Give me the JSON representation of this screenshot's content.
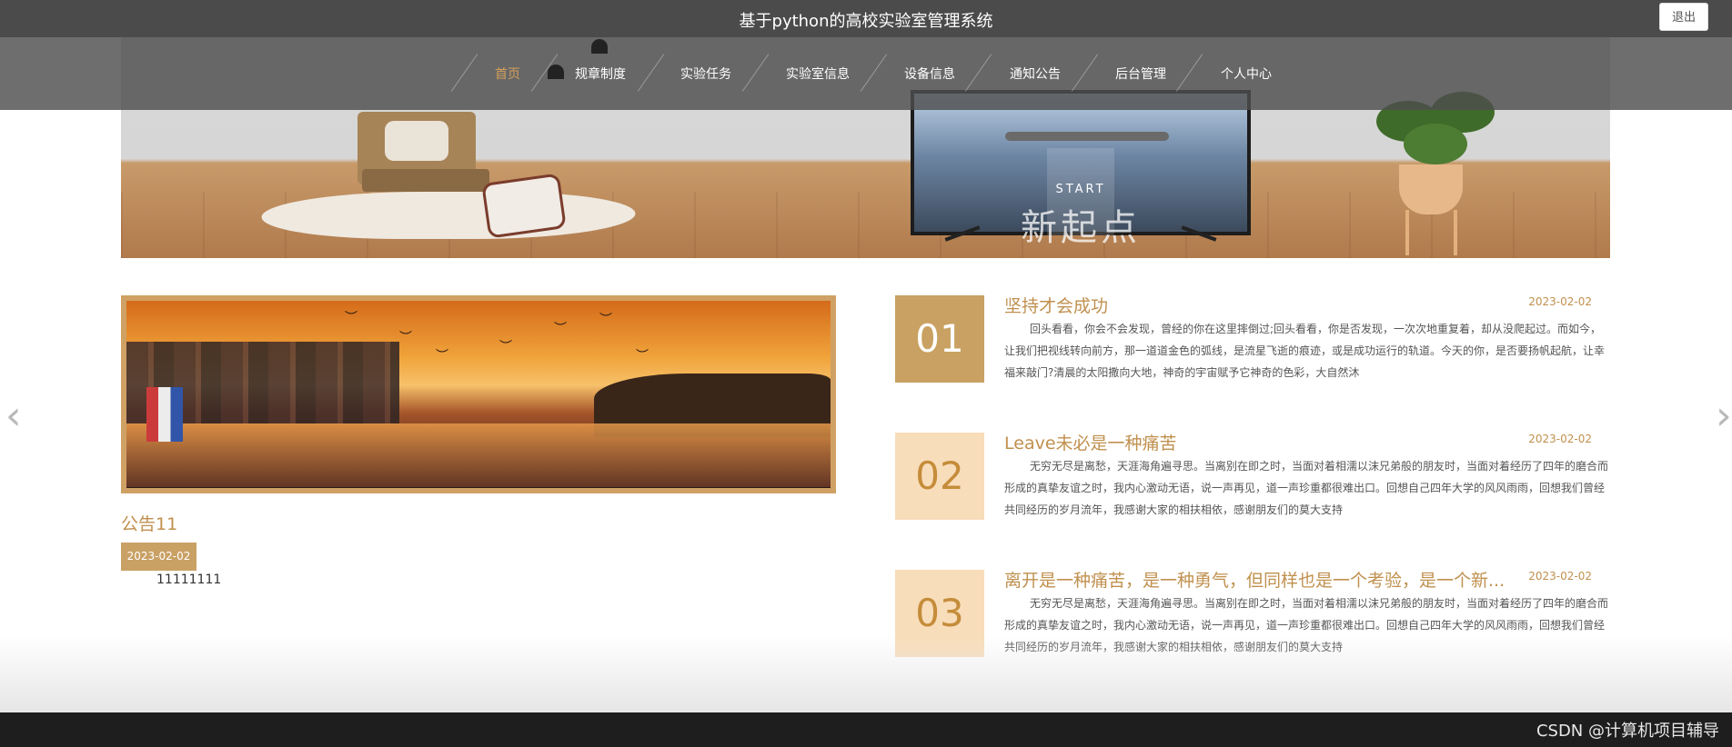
{
  "app": {
    "title": "基于python的高校实验室管理系统",
    "logout_label": "退出"
  },
  "nav": {
    "items": [
      {
        "label": "首页",
        "active": true
      },
      {
        "label": "规章制度"
      },
      {
        "label": "实验任务"
      },
      {
        "label": "实验室信息"
      },
      {
        "label": "设备信息"
      },
      {
        "label": "通知公告"
      },
      {
        "label": "后台管理"
      },
      {
        "label": "个人中心"
      }
    ]
  },
  "banner": {
    "tv_text": "新起点",
    "tv_sub": "START"
  },
  "feature": {
    "title": "公告11",
    "date": "2023-02-02",
    "body": "11111111"
  },
  "news": [
    {
      "num": "01",
      "title": "坚持才会成功",
      "date": "2023-02-02",
      "text": "回头看看，你会不会发现，曾经的你在这里摔倒过;回头看看，你是否发现，一次次地重复着，却从没爬起过。而如今，让我们把视线转向前方，那一道道金色的弧线，是流星飞逝的痕迹，或是成功运行的轨道。今天的你，是否要扬帆起航，让幸福来敲门?清晨的太阳撒向大地，神奇的宇宙赋予它神奇的色彩，大自然沐"
    },
    {
      "num": "02",
      "title": "Leave未必是一种痛苦",
      "date": "2023-02-02",
      "text": "无穷无尽是离愁，天涯海角遍寻思。当离别在即之时，当面对着相濡以沫兄弟般的朋友时，当面对着经历了四年的磨合而形成的真挚友谊之时，我内心激动无语，说一声再见，道一声珍重都很难出口。回想自己四年大学的风风雨雨，回想我们曾经共同经历的岁月流年，我感谢大家的相扶相依，感谢朋友们的莫大支持"
    },
    {
      "num": "03",
      "title": "离开是一种痛苦，是一种勇气，但同样也是一个考验，是一个新...",
      "date": "2023-02-02",
      "text": "无穷无尽是离愁，天涯海角遍寻思。当离别在即之时，当面对着相濡以沫兄弟般的朋友时，当面对着经历了四年的磨合而形成的真挚友谊之时，我内心激动无语，说一声再见，道一声珍重都很难出口。回想自己四年大学的风风雨雨，回想我们曾经共同经历的岁月流年，我感谢大家的相扶相依，感谢朋友们的莫大支持"
    }
  ],
  "carousel": {
    "prev_icon": "‹",
    "next_icon": "›"
  },
  "footer": {
    "watermark": "CSDN @计算机项目辅导"
  },
  "colors": {
    "accent": "#c0904e",
    "num_dark": "#c9a162",
    "num_light": "#f8ddba",
    "topbar": "#4b4b4b",
    "footer": "#1e1e1e"
  }
}
